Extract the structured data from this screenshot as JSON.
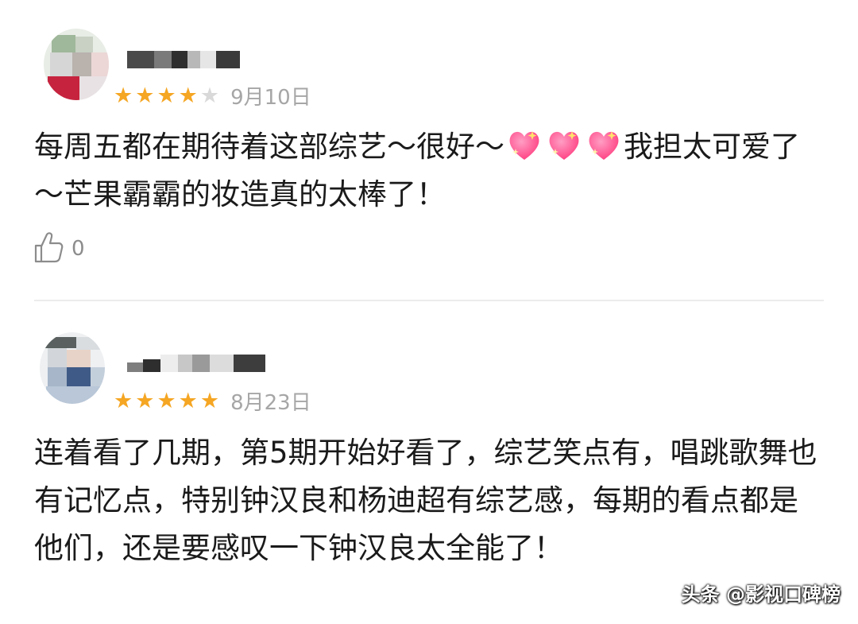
{
  "reviews": [
    {
      "rating": 4,
      "max_rating": 5,
      "date": "9月10日",
      "text_before_hearts": "每周五都在期待着这部综艺～很好～",
      "hearts": [
        "sparkling-heart",
        "sparkling-heart",
        "sparkling-heart"
      ],
      "text_after_hearts": "我担太可爱了～芒果霸霸的妆造真的太棒了！",
      "likes": "0"
    },
    {
      "rating": 5,
      "max_rating": 5,
      "date": "8月23日",
      "text": "连着看了几期，第5期开始好看了，综艺笑点有，唱跳歌舞也有记忆点，特别钟汉良和杨迪超有综艺感，每期的看点都是他们，还是要感叹一下钟汉良太全能了！"
    }
  ],
  "watermark": "头条 @影视口碑榜",
  "colors": {
    "star_on": "#f5a623",
    "star_off": "#d9d9d9",
    "date": "#a6a6a6",
    "heart": "#ff4f8b",
    "divider": "#ececec"
  },
  "icons": {
    "like": "thumbs-up-icon",
    "star": "star-icon",
    "heart": "sparkling-heart-icon"
  }
}
